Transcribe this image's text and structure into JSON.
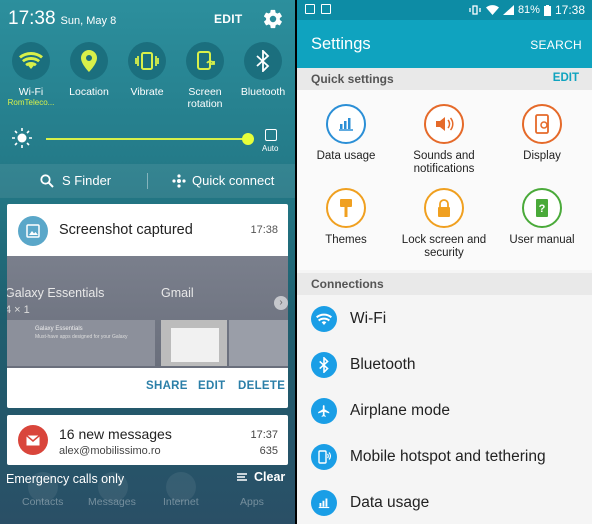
{
  "left": {
    "time": "17:38",
    "date": "Sun, May 8",
    "edit_label": "EDIT",
    "quick_settings": [
      {
        "label": "Wi-Fi",
        "sub": "RomTeleco..."
      },
      {
        "label": "Location",
        "sub": ""
      },
      {
        "label": "Vibrate",
        "sub": ""
      },
      {
        "label": "Screen rotation",
        "sub": ""
      },
      {
        "label": "Bluetooth",
        "sub": ""
      }
    ],
    "brightness": {
      "level": 0.97,
      "auto_label": "Auto"
    },
    "s_finder": "S Finder",
    "quick_connect": "Quick connect",
    "notification_screenshot": {
      "title": "Screenshot captured",
      "time": "17:38",
      "preview": {
        "widget1": "Galaxy Essentials",
        "widget1_size": "4 × 1",
        "widget2": "Gmail",
        "widget1_inner_title": "Galaxy Essentials",
        "widget1_inner_sub": "Must-have apps designed for your Galaxy"
      },
      "actions": {
        "share": "SHARE",
        "edit": "EDIT",
        "delete": "DELETE"
      }
    },
    "notification_gmail": {
      "title": "16 new messages",
      "account": "alex@mobilissimo.ro",
      "time": "17:37",
      "count": "635"
    },
    "emergency": "Emergency calls only",
    "clear": "Clear",
    "dock": [
      "Contacts",
      "Messages",
      "Internet",
      "Apps"
    ]
  },
  "right": {
    "status": {
      "battery": "81%",
      "time": "17:38"
    },
    "title": "Settings",
    "search": "SEARCH",
    "quick_header": "Quick settings",
    "quick_edit": "EDIT",
    "grid": [
      {
        "label": "Data usage",
        "color": "#2b8fd6"
      },
      {
        "label": "Sounds and notifications",
        "color": "#e56a2a"
      },
      {
        "label": "Display",
        "color": "#e56a2a"
      },
      {
        "label": "Themes",
        "color": "#f0a020"
      },
      {
        "label": "Lock screen and security",
        "color": "#f0a020"
      },
      {
        "label": "User manual",
        "color": "#4aaa3a"
      }
    ],
    "connections_header": "Connections",
    "connections": [
      {
        "label": "Wi-Fi",
        "icon": "wifi-icon"
      },
      {
        "label": "Bluetooth",
        "icon": "bluetooth-icon"
      },
      {
        "label": "Airplane mode",
        "icon": "airplane-icon"
      },
      {
        "label": "Mobile hotspot and tethering",
        "icon": "hotspot-icon"
      },
      {
        "label": "Data usage",
        "icon": "data-usage-icon"
      }
    ],
    "accent": "#0fa3bf"
  }
}
